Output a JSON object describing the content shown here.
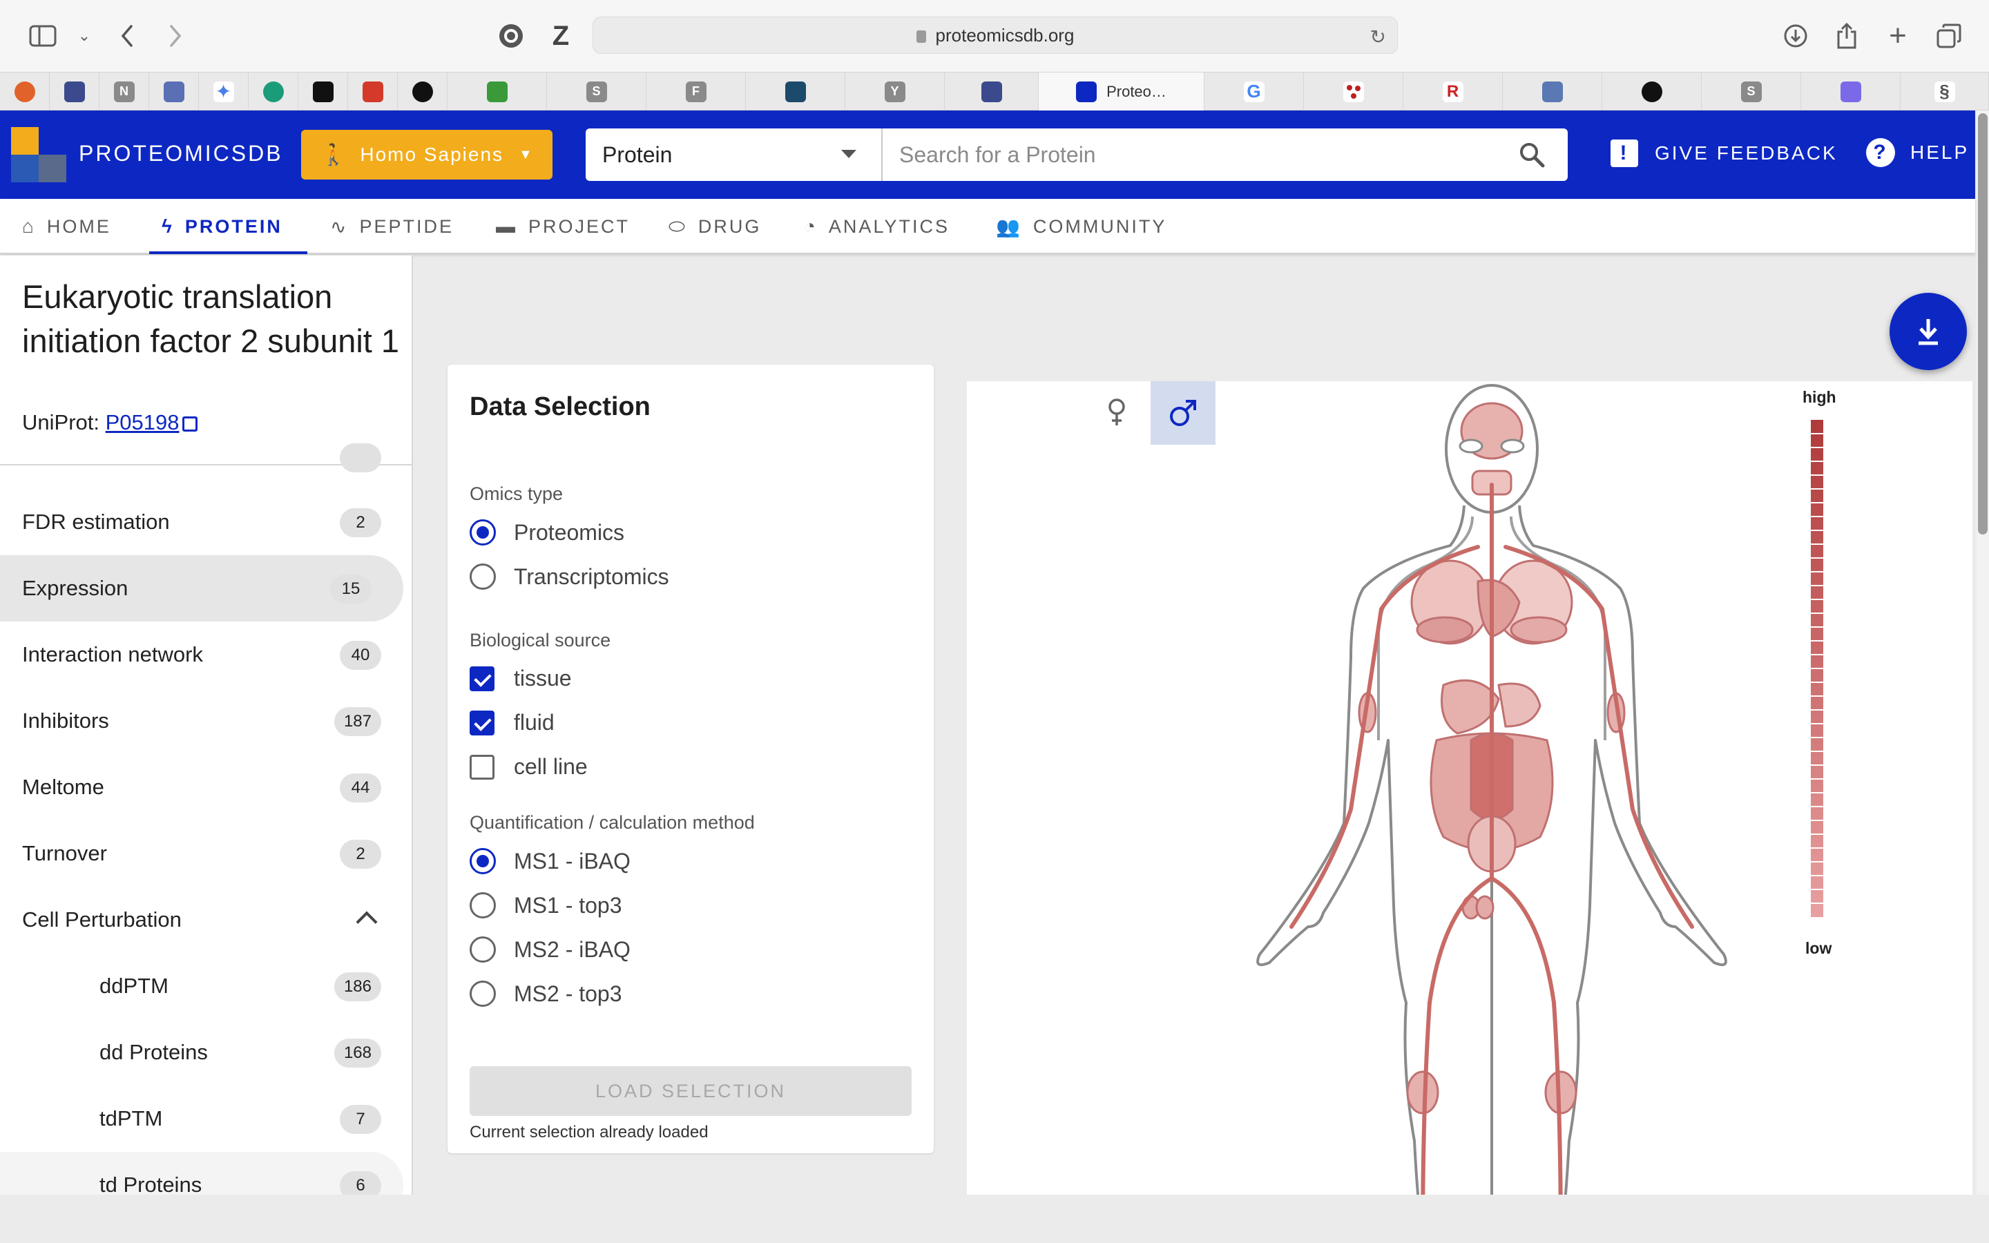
{
  "browser": {
    "url": "proteomicsdb.org",
    "active_tab_title": "Proteo…",
    "tab_letters": [
      "N",
      "S",
      "F",
      "Y",
      "S"
    ]
  },
  "header": {
    "brand": "PROTEOMICSDB",
    "organism": "Homo Sapiens",
    "search_type": "Protein",
    "search_placeholder": "Search for a Protein",
    "feedback": "GIVE FEEDBACK",
    "help": "HELP",
    "accent_color": "#0d28c2",
    "organism_color": "#f2ac1c"
  },
  "nav": {
    "tabs": [
      {
        "label": "HOME",
        "icon": "home-icon"
      },
      {
        "label": "PROTEIN",
        "icon": "protein-icon"
      },
      {
        "label": "PEPTIDE",
        "icon": "peptide-icon"
      },
      {
        "label": "PROJECT",
        "icon": "folder-icon"
      },
      {
        "label": "DRUG",
        "icon": "pill-icon"
      },
      {
        "label": "ANALYTICS",
        "icon": "analytics-icon"
      },
      {
        "label": "COMMUNITY",
        "icon": "community-icon"
      }
    ],
    "active": "PROTEIN"
  },
  "sidebar": {
    "title": "Eukaryotic translation initiation factor 2 subunit 1",
    "uniprot_label": "UniProt:",
    "uniprot_id": "P05198",
    "items": [
      {
        "label": "FDR estimation",
        "count": "2"
      },
      {
        "label": "Expression",
        "count": "15"
      },
      {
        "label": "Interaction network",
        "count": "40"
      },
      {
        "label": "Inhibitors",
        "count": "187"
      },
      {
        "label": "Meltome",
        "count": "44"
      },
      {
        "label": "Turnover",
        "count": "2"
      },
      {
        "label": "Cell Perturbation",
        "count": ""
      },
      {
        "label": "ddPTM",
        "count": "186"
      },
      {
        "label": "dd Proteins",
        "count": "168"
      },
      {
        "label": "tdPTM",
        "count": "7"
      },
      {
        "label": "td Proteins",
        "count": "6"
      }
    ]
  },
  "data_selection": {
    "title": "Data Selection",
    "omics_label": "Omics type",
    "omics_options": [
      "Proteomics",
      "Transcriptomics"
    ],
    "omics_selected": "Proteomics",
    "source_label": "Biological source",
    "source_options": [
      "tissue",
      "fluid",
      "cell line"
    ],
    "source_checked": [
      "tissue",
      "fluid"
    ],
    "method_label": "Quantification / calculation method",
    "method_options": [
      "MS1 - iBAQ",
      "MS1 - top3",
      "MS2 - iBAQ",
      "MS2 - top3"
    ],
    "method_selected": "MS1 - iBAQ",
    "load_button": "LOAD SELECTION",
    "loaded_note": "Current selection already loaded"
  },
  "body_map": {
    "selected_gender": "male",
    "legend_high": "high",
    "legend_low": "low",
    "high_color": "#b03a3a",
    "low_color": "#e8a0a0"
  }
}
